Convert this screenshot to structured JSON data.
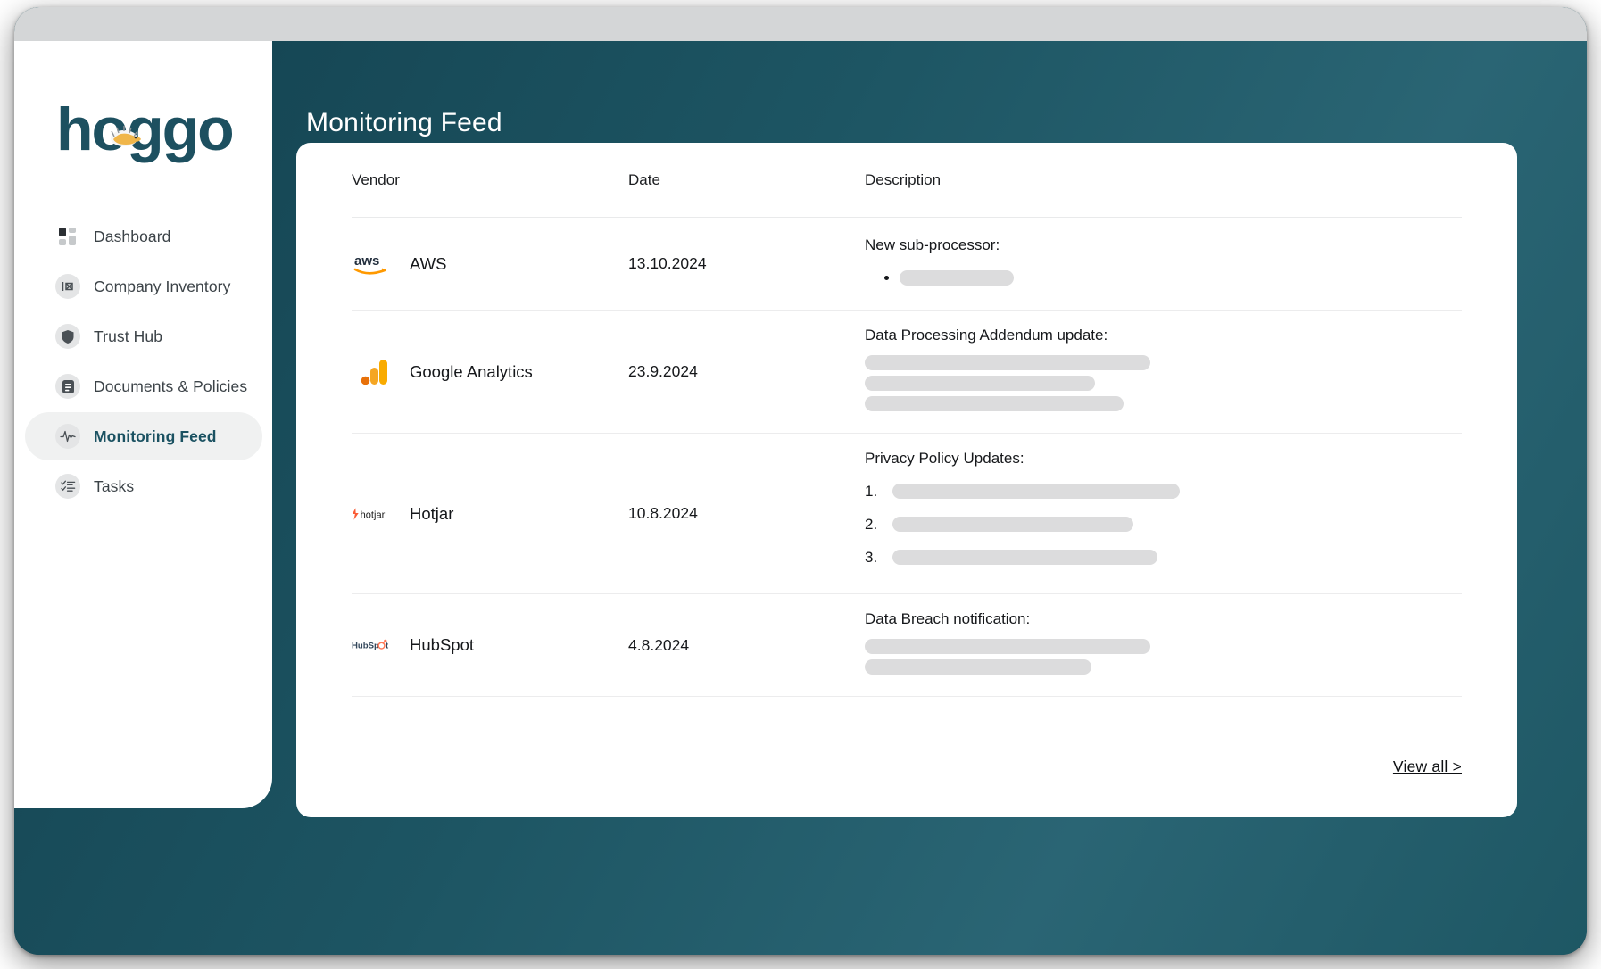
{
  "brand": {
    "logo_text": "hoggo",
    "logo_color": "#1d5060",
    "mascot_color": "#f0b64a"
  },
  "window": {
    "titlebar_color": "#d4d6d7",
    "workspace_color": "#1d5563"
  },
  "sidebar": {
    "items": [
      {
        "label": "Dashboard",
        "icon": "dashboard-grid-icon",
        "active": false
      },
      {
        "label": "Company Inventory",
        "icon": "inventory-box-icon",
        "active": false
      },
      {
        "label": "Trust Hub",
        "icon": "shield-icon",
        "active": false
      },
      {
        "label": "Documents & Policies",
        "icon": "document-icon",
        "active": false
      },
      {
        "label": "Monitoring Feed",
        "icon": "pulse-activity-icon",
        "active": true
      },
      {
        "label": "Tasks",
        "icon": "checklist-icon",
        "active": false
      }
    ],
    "active_color": "#1b5262",
    "active_background": "#f0f1f1"
  },
  "header": {
    "title": "Monitoring Feed"
  },
  "table": {
    "columns": [
      "Vendor",
      "Date",
      "Description"
    ],
    "rows": [
      {
        "vendor": "AWS",
        "logo": "aws-logo",
        "date": "13.10.2024",
        "desc_title": "New sub-processor:",
        "list_type": "bullet",
        "redacted_widths": [
          "128px"
        ]
      },
      {
        "vendor": "Google Analytics",
        "logo": "google-analytics-logo",
        "date": "23.9.2024",
        "desc_title": "Data Processing Addendum update:",
        "list_type": "none",
        "redacted_widths": [
          "320px",
          "258px",
          "290px"
        ]
      },
      {
        "vendor": "Hotjar",
        "logo": "hotjar-logo",
        "date": "10.8.2024",
        "desc_title": "Privacy Policy Updates:",
        "list_type": "numbered",
        "numbers": [
          "1.",
          "2.",
          "3."
        ],
        "redacted_widths": [
          "322px",
          "270px",
          "297px"
        ]
      },
      {
        "vendor": "HubSpot",
        "logo": "hubspot-logo",
        "date": "4.8.2024",
        "desc_title": "Data Breach notification:",
        "list_type": "none",
        "redacted_widths": [
          "320px",
          "254px"
        ]
      }
    ]
  },
  "footer": {
    "view_all_label": "View all >"
  }
}
